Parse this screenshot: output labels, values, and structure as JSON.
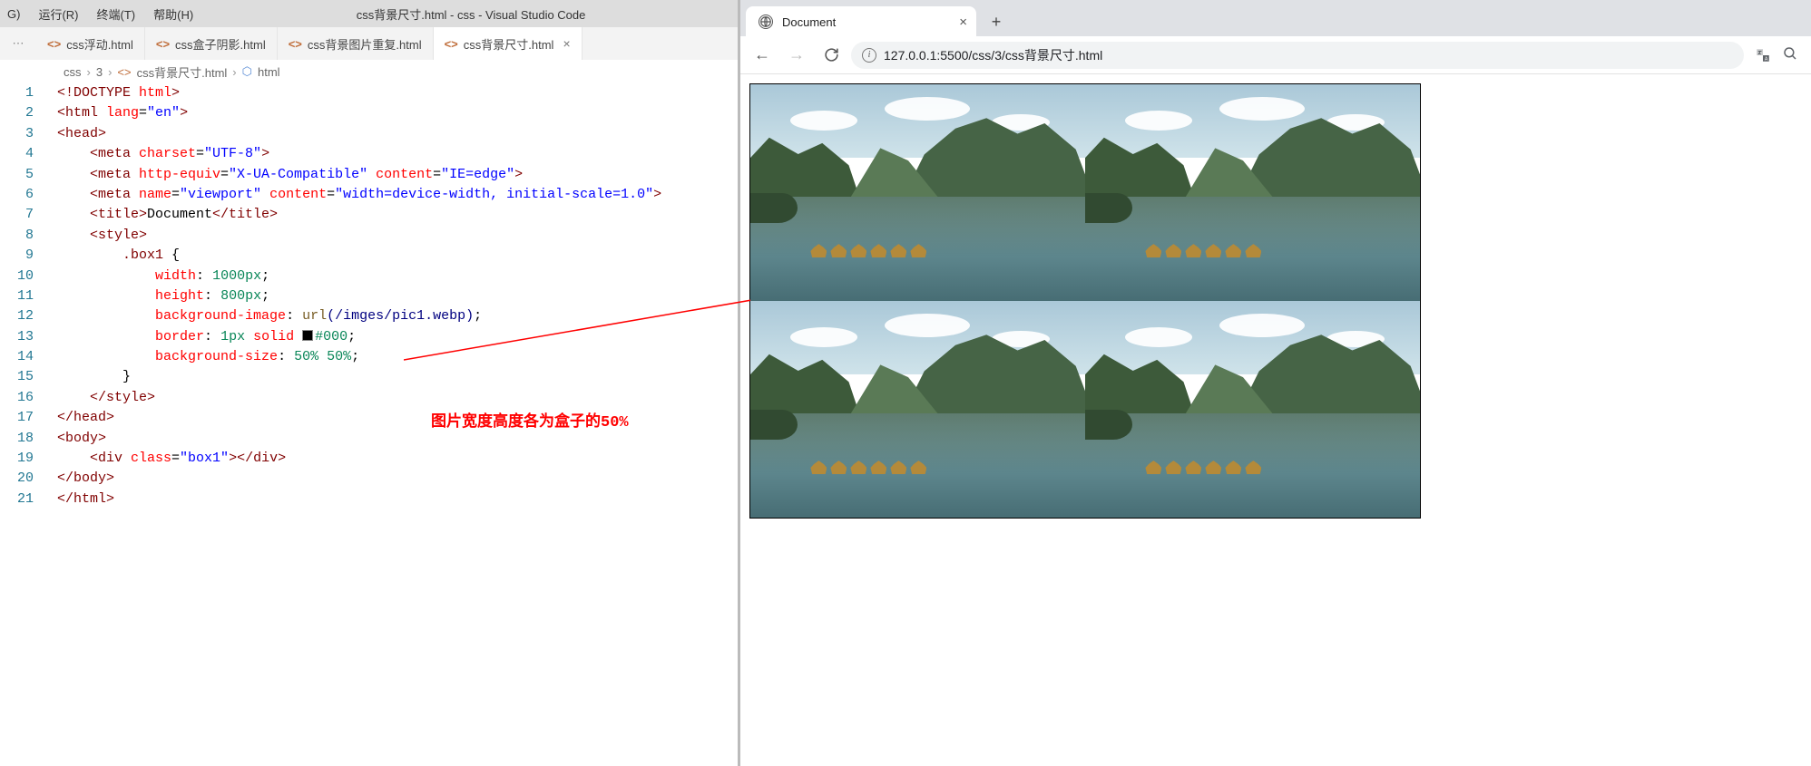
{
  "menu": {
    "run": "运行(R)",
    "terminal": "终端(T)",
    "help": "帮助(H)",
    "g": "G)"
  },
  "window_title": "css背景尺寸.html - css - Visual Studio Code",
  "tabs": [
    {
      "label": "css浮动.html"
    },
    {
      "label": "css盒子阴影.html"
    },
    {
      "label": "css背景图片重复.html"
    },
    {
      "label": "css背景尺寸.html",
      "active": true
    }
  ],
  "breadcrumb": {
    "p1": "css",
    "p2": "3",
    "p3": "css背景尺寸.html",
    "p4": "html",
    "file_icon": "<>",
    "cube_icon": "⬡"
  },
  "code": {
    "l1": {
      "doctype": "<!DOCTYPE ",
      "htmlkw": "html",
      "end": ">"
    },
    "l2": {
      "open": "<html ",
      "attr": "lang",
      "eq": "=",
      "val": "\"en\"",
      "close": ">"
    },
    "l3": {
      "tag": "<head>"
    },
    "l4": {
      "open": "    <meta ",
      "attr": "charset",
      "eq": "=",
      "val": "\"UTF-8\"",
      "close": ">"
    },
    "l5": {
      "open": "    <meta ",
      "a1": "http-equiv",
      "v1": "\"X-UA-Compatible\"",
      "a2": "content",
      "v2": "\"IE=edge\"",
      "close": ">"
    },
    "l6": {
      "open": "    <meta ",
      "a1": "name",
      "v1": "\"viewport\"",
      "a2": "content",
      "v2": "\"width=device-width, initial-scale=1.0\"",
      "close": ">"
    },
    "l7": {
      "open": "    <title>",
      "text": "Document",
      "close": "</title>"
    },
    "l8": {
      "tag": "    <style>"
    },
    "l9": {
      "sel": "        .box1 ",
      "br": "{"
    },
    "l10": {
      "ind": "            ",
      "prop": "width",
      "colon": ": ",
      "val": "1000px",
      "semi": ";"
    },
    "l11": {
      "ind": "            ",
      "prop": "height",
      "colon": ": ",
      "val": "800px",
      "semi": ";"
    },
    "l12": {
      "ind": "            ",
      "prop": "background-image",
      "colon": ": ",
      "fn": "url",
      "arg": "(/imges/pic1.webp)",
      "semi": ";"
    },
    "l13": {
      "ind": "            ",
      "prop": "border",
      "colon": ": ",
      "v1": "1px ",
      "v2": "solid ",
      "hex": "#000",
      "semi": ";"
    },
    "l14": {
      "ind": "            ",
      "prop": "background-size",
      "colon": ": ",
      "val": "50% 50%",
      "semi": ";"
    },
    "l15": {
      "ind": "        ",
      "br": "}"
    },
    "l16": {
      "tag": "    </style>"
    },
    "l17": {
      "tag": "</head>"
    },
    "l18": {
      "tag": "<body>"
    },
    "l19": {
      "open": "    <div ",
      "attr": "class",
      "eq": "=",
      "val": "\"box1\"",
      "mid": ">",
      "close": "</div>"
    },
    "l20": {
      "tag": "</body>"
    },
    "l21": {
      "tag": "</html>"
    }
  },
  "lines": [
    "1",
    "2",
    "3",
    "4",
    "5",
    "6",
    "7",
    "8",
    "9",
    "10",
    "11",
    "12",
    "13",
    "14",
    "15",
    "16",
    "17",
    "18",
    "19",
    "20",
    "21"
  ],
  "annotation": "图片宽度高度各为盒子的50%",
  "browser": {
    "tab_title": "Document",
    "url": "127.0.0.1:5500/css/3/css背景尺寸.html",
    "info_glyph": "i"
  }
}
